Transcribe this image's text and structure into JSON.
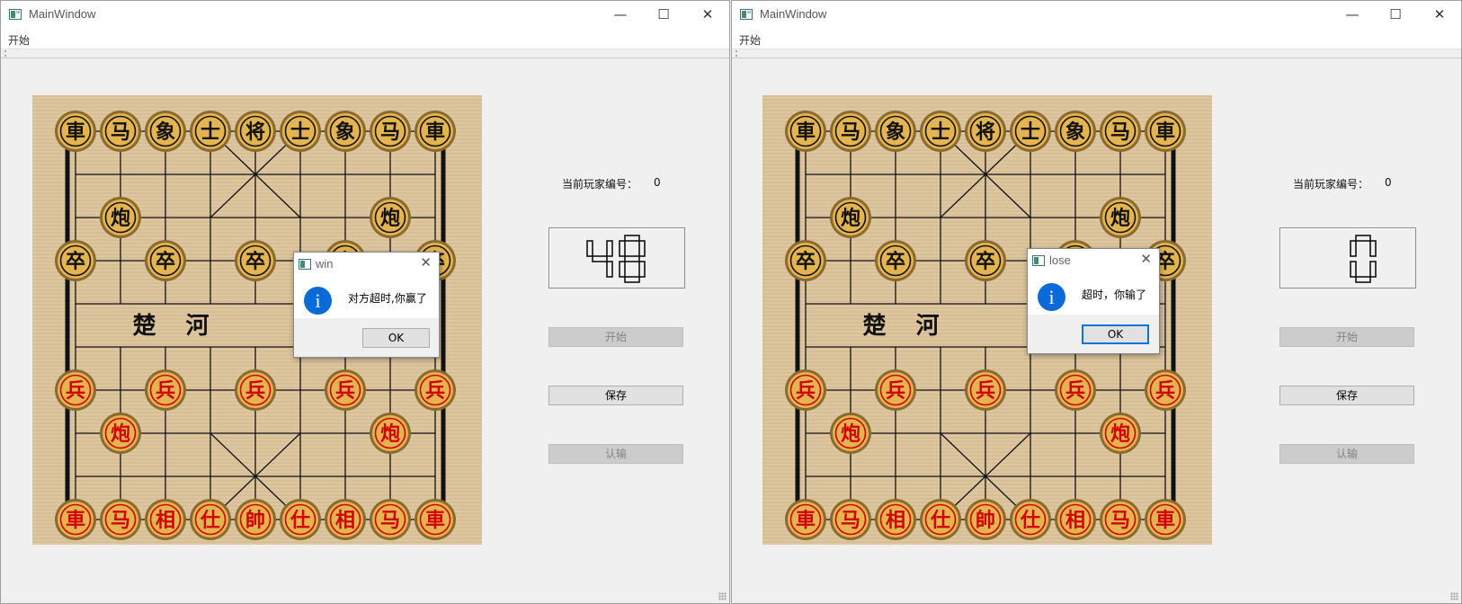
{
  "windows": [
    {
      "title": "MainWindow",
      "menu": [
        "开始"
      ],
      "player_label": "当前玩家编号：",
      "player_value": "0",
      "timer": "48",
      "buttons": {
        "start": "开始",
        "save": "保存",
        "resign": "认输"
      },
      "dialog": {
        "title": "win",
        "message": "对方超时,你赢了",
        "ok": "OK"
      }
    },
    {
      "title": "MainWindow",
      "menu": [
        "开始"
      ],
      "player_label": "当前玩家编号：",
      "player_value": "0",
      "timer": "0",
      "buttons": {
        "start": "开始",
        "save": "保存",
        "resign": "认输"
      },
      "dialog": {
        "title": "lose",
        "message": "超时，你输了",
        "ok": "OK"
      }
    }
  ],
  "window_controls": {
    "minimize": "—",
    "maximize": "☐",
    "close": "✕"
  },
  "board": {
    "river_text": "楚 河",
    "black_pieces": [
      {
        "col": 0,
        "row": 0,
        "text": "車"
      },
      {
        "col": 1,
        "row": 0,
        "text": "马"
      },
      {
        "col": 2,
        "row": 0,
        "text": "象"
      },
      {
        "col": 3,
        "row": 0,
        "text": "士"
      },
      {
        "col": 4,
        "row": 0,
        "text": "将"
      },
      {
        "col": 5,
        "row": 0,
        "text": "士"
      },
      {
        "col": 6,
        "row": 0,
        "text": "象"
      },
      {
        "col": 7,
        "row": 0,
        "text": "马"
      },
      {
        "col": 8,
        "row": 0,
        "text": "車"
      },
      {
        "col": 1,
        "row": 2,
        "text": "炮"
      },
      {
        "col": 7,
        "row": 2,
        "text": "炮"
      },
      {
        "col": 0,
        "row": 3,
        "text": "卒"
      },
      {
        "col": 2,
        "row": 3,
        "text": "卒"
      },
      {
        "col": 4,
        "row": 3,
        "text": "卒"
      },
      {
        "col": 6,
        "row": 3,
        "text": "卒"
      },
      {
        "col": 8,
        "row": 3,
        "text": "卒"
      }
    ],
    "red_pieces": [
      {
        "col": 0,
        "row": 6,
        "text": "兵"
      },
      {
        "col": 2,
        "row": 6,
        "text": "兵"
      },
      {
        "col": 4,
        "row": 6,
        "text": "兵"
      },
      {
        "col": 6,
        "row": 6,
        "text": "兵"
      },
      {
        "col": 8,
        "row": 6,
        "text": "兵"
      },
      {
        "col": 1,
        "row": 7,
        "text": "炮"
      },
      {
        "col": 7,
        "row": 7,
        "text": "炮"
      },
      {
        "col": 0,
        "row": 9,
        "text": "車"
      },
      {
        "col": 1,
        "row": 9,
        "text": "马"
      },
      {
        "col": 2,
        "row": 9,
        "text": "相"
      },
      {
        "col": 3,
        "row": 9,
        "text": "仕"
      },
      {
        "col": 4,
        "row": 9,
        "text": "帥"
      },
      {
        "col": 5,
        "row": 9,
        "text": "仕"
      },
      {
        "col": 6,
        "row": 9,
        "text": "相"
      },
      {
        "col": 7,
        "row": 9,
        "text": "马"
      },
      {
        "col": 8,
        "row": 9,
        "text": "車"
      }
    ],
    "colors": {
      "black_text": "#111111",
      "red_text": "#d40000",
      "piece_face": "#e3b450",
      "piece_rim": "#8a6a2e"
    }
  }
}
